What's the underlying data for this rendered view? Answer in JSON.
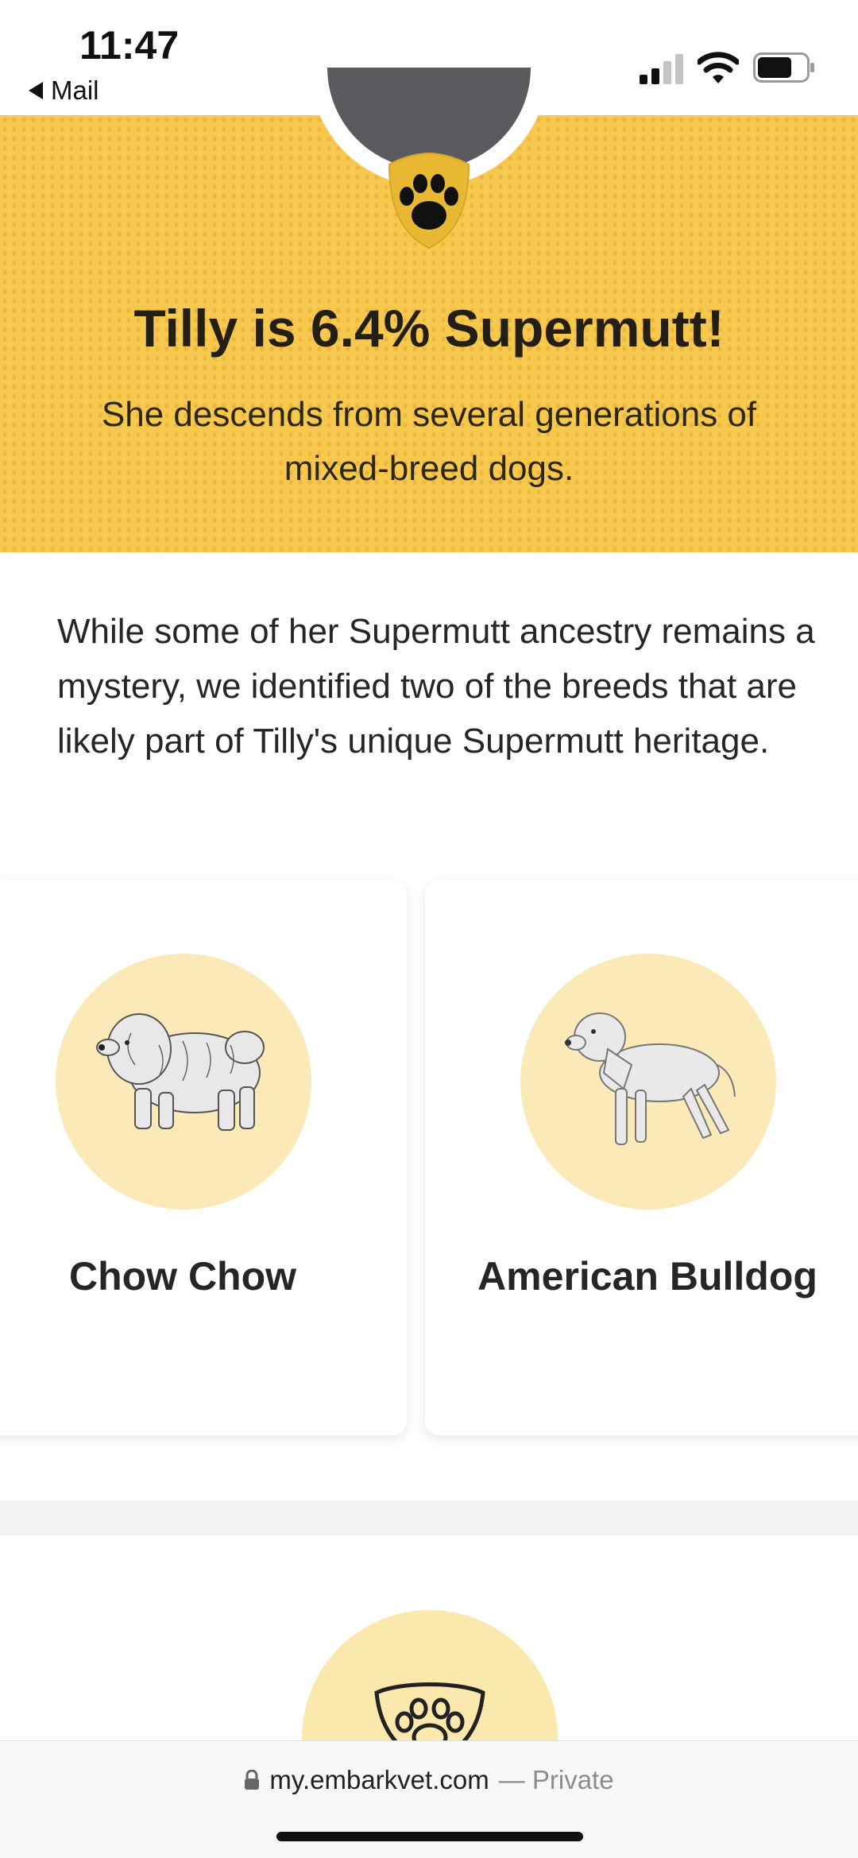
{
  "status_bar": {
    "time": "11:47",
    "back_label": "Mail",
    "icons": [
      "signal-icon",
      "wifi-icon",
      "battery-icon"
    ]
  },
  "hero": {
    "title": "Tilly is 6.4% Supermutt!",
    "subtitle": "She descends from several generations of mixed-breed dogs.",
    "badge_icon": "paw-icon"
  },
  "intro_text": "While some of her Supermutt ancestry remains a mystery, we identified two of the breeds that are likely part of Tilly's unique Supermutt heritage.",
  "breeds": [
    {
      "name": "Chow Chow",
      "icon": "chow-chow-illustration"
    },
    {
      "name": "American Bulldog",
      "icon": "american-bulldog-illustration"
    }
  ],
  "next_section": {
    "icon": "paw-shield-icon"
  },
  "browser": {
    "domain": "my.embarkvet.com",
    "private_label": "— Private",
    "icon": "lock-icon"
  },
  "colors": {
    "hero_yellow": "#f6c84e",
    "circle_yellow": "#fbeab7",
    "text_dark": "#222222"
  }
}
